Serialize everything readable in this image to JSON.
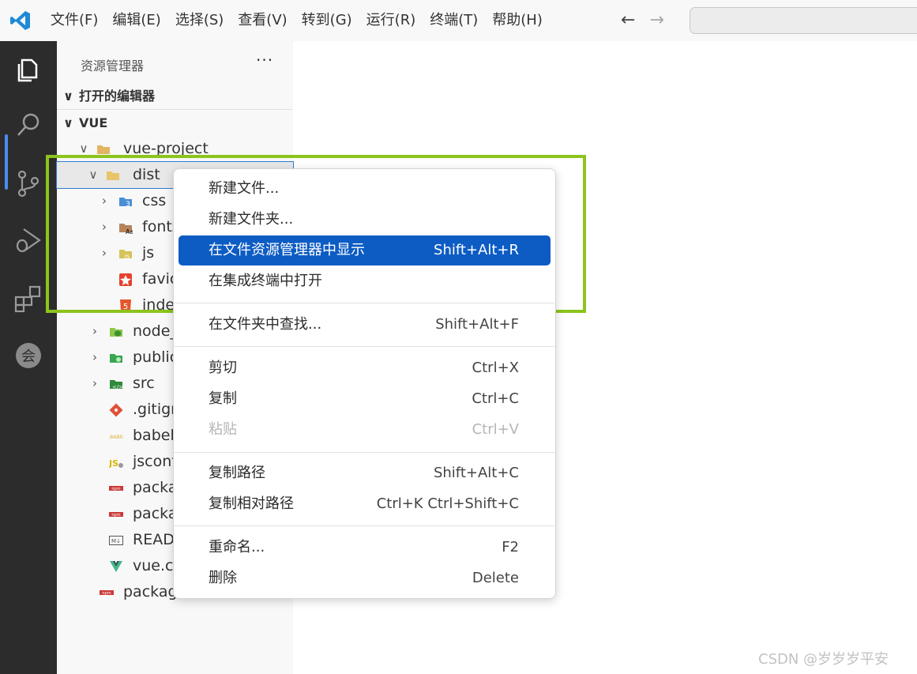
{
  "menubar": {
    "items": [
      "文件(F)",
      "编辑(E)",
      "选择(S)",
      "查看(V)",
      "转到(G)",
      "运行(R)",
      "终端(T)",
      "帮助(H)"
    ],
    "back_icon": "arrow-left",
    "forward_icon": "arrow-right",
    "search_placeholder": ""
  },
  "activitybar": {
    "items": [
      "explorer-icon",
      "search-icon",
      "source-control-icon",
      "run-debug-icon",
      "extensions-icon",
      "account-icon"
    ],
    "active": "explorer-icon"
  },
  "sidebar": {
    "title": "资源管理器",
    "more": "···",
    "open_editors": "打开的编辑器",
    "workspace": "VUE",
    "tree": [
      {
        "label": "vue-project",
        "icon": "folder-icon",
        "expanded": true
      },
      {
        "label": "dist",
        "icon": "folder-icon",
        "expanded": true,
        "selected": true
      },
      {
        "label": "css",
        "icon": "css-folder-icon"
      },
      {
        "label": "fonts",
        "icon": "fonts-folder-icon"
      },
      {
        "label": "js",
        "icon": "js-folder-icon"
      },
      {
        "label": "favic",
        "icon": "favicon-icon"
      },
      {
        "label": "inde",
        "icon": "html-icon"
      },
      {
        "label": "node_",
        "icon": "node-folder-icon"
      },
      {
        "label": "public",
        "icon": "public-folder-icon"
      },
      {
        "label": "src",
        "icon": "src-folder-icon"
      },
      {
        "label": ".gitigr",
        "icon": "git-icon"
      },
      {
        "label": "babel.",
        "icon": "babel-icon"
      },
      {
        "label": "jsconf",
        "icon": "jsconfig-icon"
      },
      {
        "label": "packa",
        "icon": "npm-icon"
      },
      {
        "label": "packa",
        "icon": "npm-icon"
      },
      {
        "label": "READ",
        "icon": "markdown-icon"
      },
      {
        "label": "vue.co",
        "icon": "vue-icon"
      },
      {
        "label": "packag",
        "icon": "npm-icon"
      }
    ]
  },
  "context_menu": {
    "groups": [
      [
        {
          "label": "新建文件...",
          "shortcut": ""
        },
        {
          "label": "新建文件夹...",
          "shortcut": ""
        },
        {
          "label": "在文件资源管理器中显示",
          "shortcut": "Shift+Alt+R",
          "active": true
        },
        {
          "label": "在集成终端中打开",
          "shortcut": ""
        }
      ],
      [
        {
          "label": "在文件夹中查找...",
          "shortcut": "Shift+Alt+F"
        }
      ],
      [
        {
          "label": "剪切",
          "shortcut": "Ctrl+X"
        },
        {
          "label": "复制",
          "shortcut": "Ctrl+C"
        },
        {
          "label": "粘贴",
          "shortcut": "Ctrl+V",
          "disabled": true
        }
      ],
      [
        {
          "label": "复制路径",
          "shortcut": "Shift+Alt+C"
        },
        {
          "label": "复制相对路径",
          "shortcut": "Ctrl+K Ctrl+Shift+C"
        }
      ],
      [
        {
          "label": "重命名...",
          "shortcut": "F2"
        },
        {
          "label": "删除",
          "shortcut": "Delete"
        }
      ]
    ]
  },
  "watermark": "CSDN @岁岁岁平安",
  "colors": {
    "accent": "#0d5cc4",
    "highlight_box": "#8cc41c",
    "activitybar": "#2c2c2c"
  }
}
